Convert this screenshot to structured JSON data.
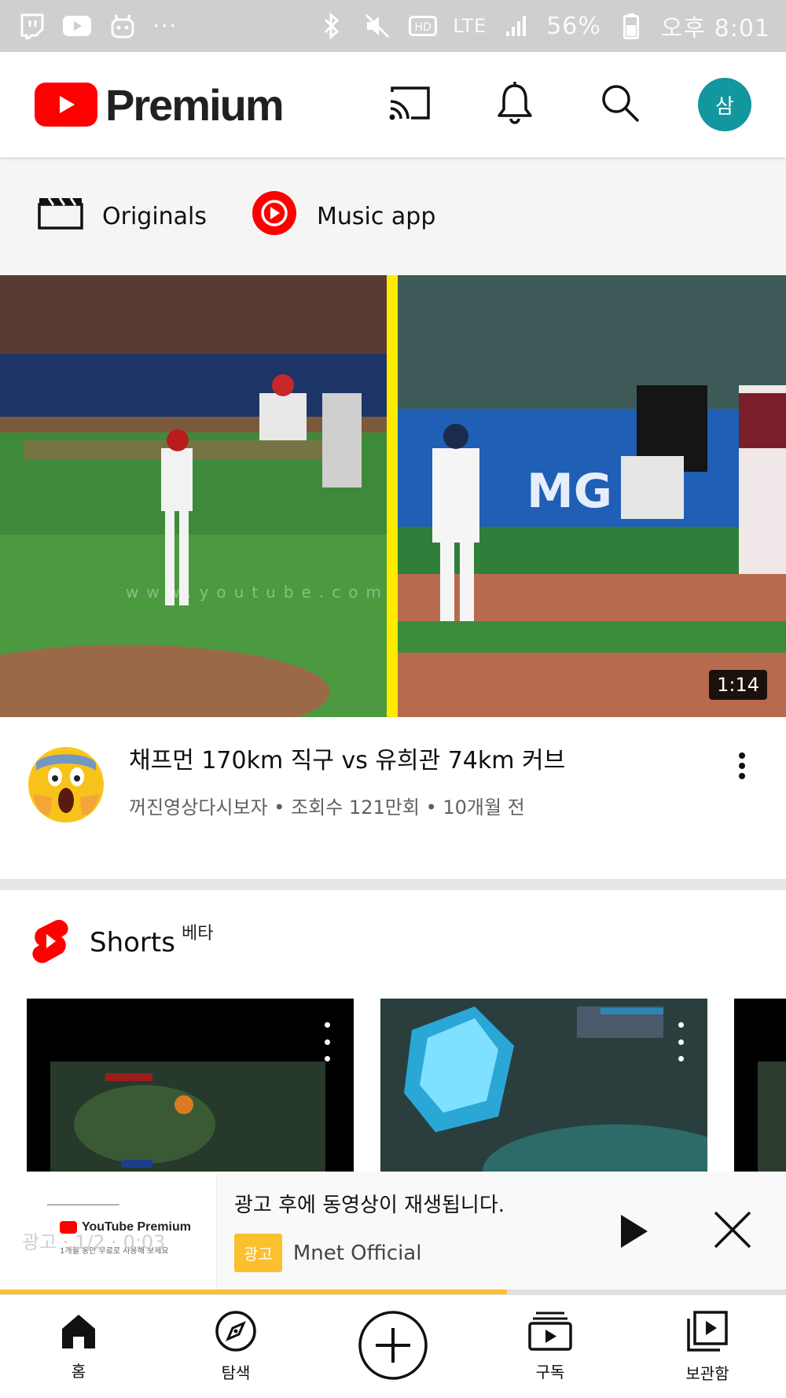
{
  "status_bar": {
    "battery": "56%",
    "time": "오후 8:01",
    "network": "LTE",
    "hd": "HD",
    "overflow": "···"
  },
  "header": {
    "logo_text": "Premium",
    "avatar_letter": "삼"
  },
  "chips": [
    {
      "label": "Originals",
      "icon": "clapperboard-icon"
    },
    {
      "label": "Music app",
      "icon": "youtube-music-icon"
    }
  ],
  "video": {
    "duration": "1:14",
    "title": "채프먼 170km 직구 vs 유희관 74km 커브",
    "channel": "꺼진영상다시보자",
    "views": "조회수 121만회",
    "age": "10개월 전",
    "separator": "•"
  },
  "shorts": {
    "title": "Shorts",
    "badge": "베타"
  },
  "mini_player": {
    "thumb_overlay": "광고 · 1/2 · 0:03",
    "thumb_brand": "YouTube Premium",
    "thumb_caption": "1개월 동안 무료로 사용해 보세요",
    "message": "광고 후에 동영상이 재생됩니다.",
    "badge": "광고",
    "channel": "Mnet Official",
    "progress": 0.645
  },
  "bottom_nav": [
    {
      "label": "홈",
      "icon": "home-icon"
    },
    {
      "label": "탐색",
      "icon": "compass-icon"
    },
    {
      "label": "",
      "icon": "create-plus-icon"
    },
    {
      "label": "구독",
      "icon": "subscriptions-icon"
    },
    {
      "label": "보관함",
      "icon": "library-icon"
    }
  ],
  "colors": {
    "brand_red": "#FF0000",
    "avatar_teal": "#12979E",
    "ad_yellow": "#FBC02D",
    "split_yellow": "#FFEB00"
  }
}
